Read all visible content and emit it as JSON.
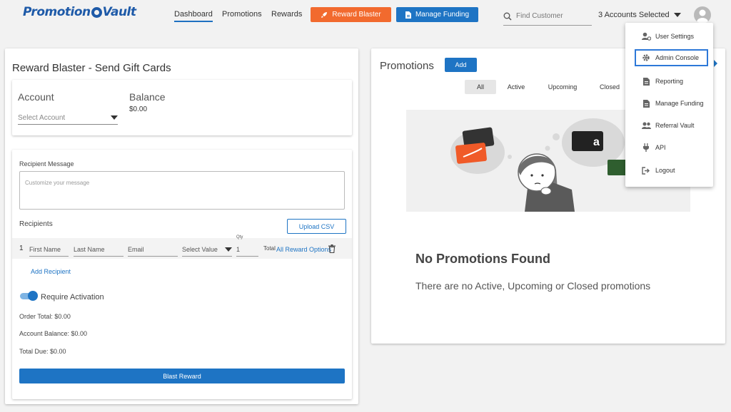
{
  "brand": {
    "logo_text_1": "Promotion",
    "logo_text_2": "Vault"
  },
  "nav": {
    "dashboard": "Dashboard",
    "promotions": "Promotions",
    "rewards": "Rewards",
    "reward_blaster": "Reward Blaster",
    "manage_funding": "Manage Funding"
  },
  "search": {
    "placeholder": "Find Customer"
  },
  "accounts": {
    "selected": "3 Accounts Selected"
  },
  "menu": {
    "items": [
      {
        "label": "User Settings",
        "icon": "user-gear-icon"
      },
      {
        "label": "Admin Console",
        "icon": "gear-icon"
      },
      {
        "label": "Reporting",
        "icon": "document-icon"
      },
      {
        "label": "Manage Funding",
        "icon": "document-icon"
      },
      {
        "label": "Referral Vault",
        "icon": "users-icon"
      },
      {
        "label": "API",
        "icon": "plug-icon"
      },
      {
        "label": "Logout",
        "icon": "logout-icon"
      }
    ]
  },
  "reward_blaster": {
    "title": "Reward Blaster - Send Gift Cards",
    "account_label": "Account",
    "account_placeholder": "Select Account",
    "balance_label": "Balance",
    "balance_value": "$0.00",
    "recipient_message_label": "Recipient Message",
    "message_placeholder": "Customize your message",
    "recipients_label": "Recipients",
    "upload_csv": "Upload CSV",
    "row": {
      "number": "1",
      "first_name": "First Name",
      "last_name": "Last Name",
      "email": "Email",
      "select_value": "Select Value",
      "qty_label": "Qty",
      "qty_value": "1",
      "total": "Total",
      "all_reward_options": "All Reward Options"
    },
    "add_recipient": "Add Recipient",
    "require_activation": "Require Activation",
    "require_activation_on": true,
    "order_total": "Order Total: $0.00",
    "account_balance": "Account Balance: $0.00",
    "total_due": "Total Due: $0.00",
    "blast_button": "Blast Reward"
  },
  "promotions": {
    "title": "Promotions",
    "add_button": "Add",
    "tabs": [
      "All",
      "Active",
      "Upcoming",
      "Closed"
    ],
    "active_tab": "All",
    "empty_title": "No Promotions Found",
    "empty_subtitle": "There are no Active, Upcoming or Closed promotions"
  },
  "colors": {
    "brand_blue": "#1e74c4",
    "orange": "#f26a2e",
    "focus_outline": "#2d78d8"
  }
}
